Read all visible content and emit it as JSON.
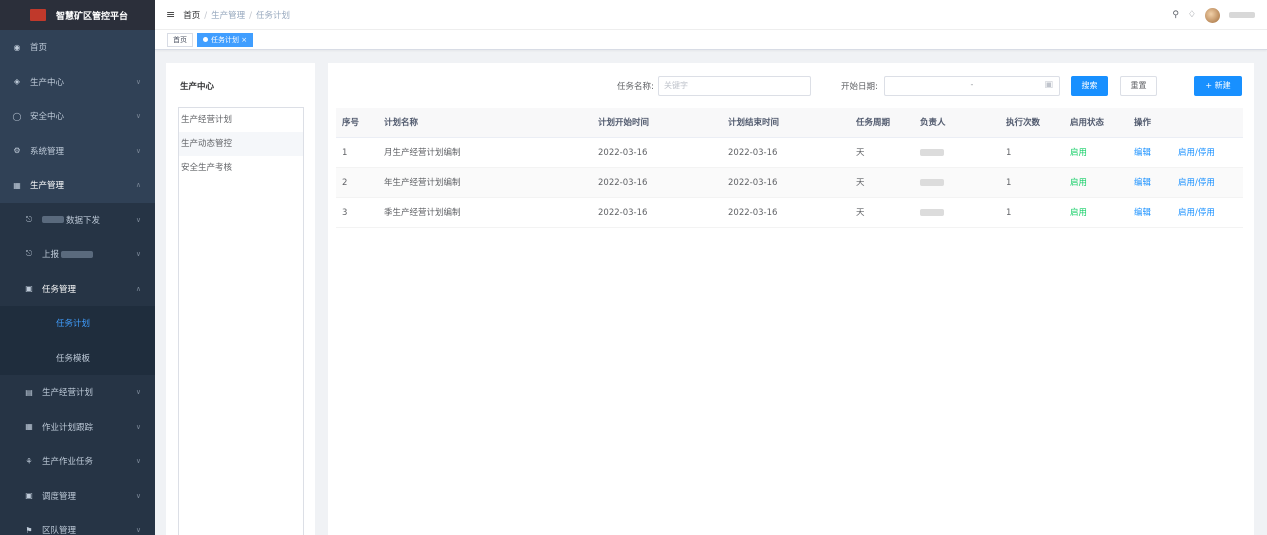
{
  "app": {
    "title": "智慧矿区管控平台"
  },
  "sidebar": {
    "items": [
      {
        "label": "首页",
        "icon": "dashboard-icon"
      },
      {
        "label": "生产中心",
        "icon": "stack-icon"
      },
      {
        "label": "安全中心",
        "icon": "shield-icon"
      },
      {
        "label": "系统管理",
        "icon": "gear-icon"
      },
      {
        "label": "生产管理",
        "icon": "grid-icon"
      }
    ],
    "sub": [
      {
        "label_suffix": "数据下发",
        "icon": "upload-icon"
      },
      {
        "label_prefix": "上报",
        "icon": "report-icon"
      },
      {
        "label": "任务管理",
        "icon": "task-icon"
      }
    ],
    "task_sub": [
      {
        "label": "任务计划"
      },
      {
        "label": "任务模板"
      }
    ],
    "more": [
      {
        "label": "生产经营计划",
        "icon": "plan-icon"
      },
      {
        "label": "作业计划跟踪",
        "icon": "track-icon"
      },
      {
        "label": "生产作业任务",
        "icon": "work-icon"
      },
      {
        "label": "调度管理",
        "icon": "dispatch-icon"
      },
      {
        "label": "区队管理",
        "icon": "flag-icon"
      }
    ]
  },
  "breadcrumb": [
    "首页",
    "生产管理",
    "任务计划"
  ],
  "tags": {
    "home": "首页",
    "active": "任务计划"
  },
  "tree": {
    "title": "生产中心",
    "items": [
      "生产经营计划",
      "生产动态管控",
      "安全生产考核"
    ]
  },
  "search": {
    "name_label": "任务名称:",
    "name_placeholder": "关键字",
    "date_label": "开始日期:",
    "date_sep": "-",
    "search_btn": "搜索",
    "reset_btn": "重置",
    "new_btn": "+ 新建"
  },
  "table": {
    "headers": [
      "序号",
      "计划名称",
      "计划开始时间",
      "计划结束时间",
      "任务周期",
      "负责人",
      "执行次数",
      "启用状态",
      "操作"
    ],
    "rows": [
      {
        "no": "1",
        "name": "月生产经营计划编制",
        "start": "2022-03-16",
        "end": "2022-03-16",
        "cycle": "天",
        "count": "1",
        "status": "启用",
        "edit": "编辑",
        "toggle": "启用/停用"
      },
      {
        "no": "2",
        "name": "年生产经营计划编制",
        "start": "2022-03-16",
        "end": "2022-03-16",
        "cycle": "天",
        "count": "1",
        "status": "启用",
        "edit": "编辑",
        "toggle": "启用/停用"
      },
      {
        "no": "3",
        "name": "季生产经营计划编制",
        "start": "2022-03-16",
        "end": "2022-03-16",
        "cycle": "天",
        "count": "1",
        "status": "启用",
        "edit": "编辑",
        "toggle": "启用/停用"
      }
    ]
  }
}
